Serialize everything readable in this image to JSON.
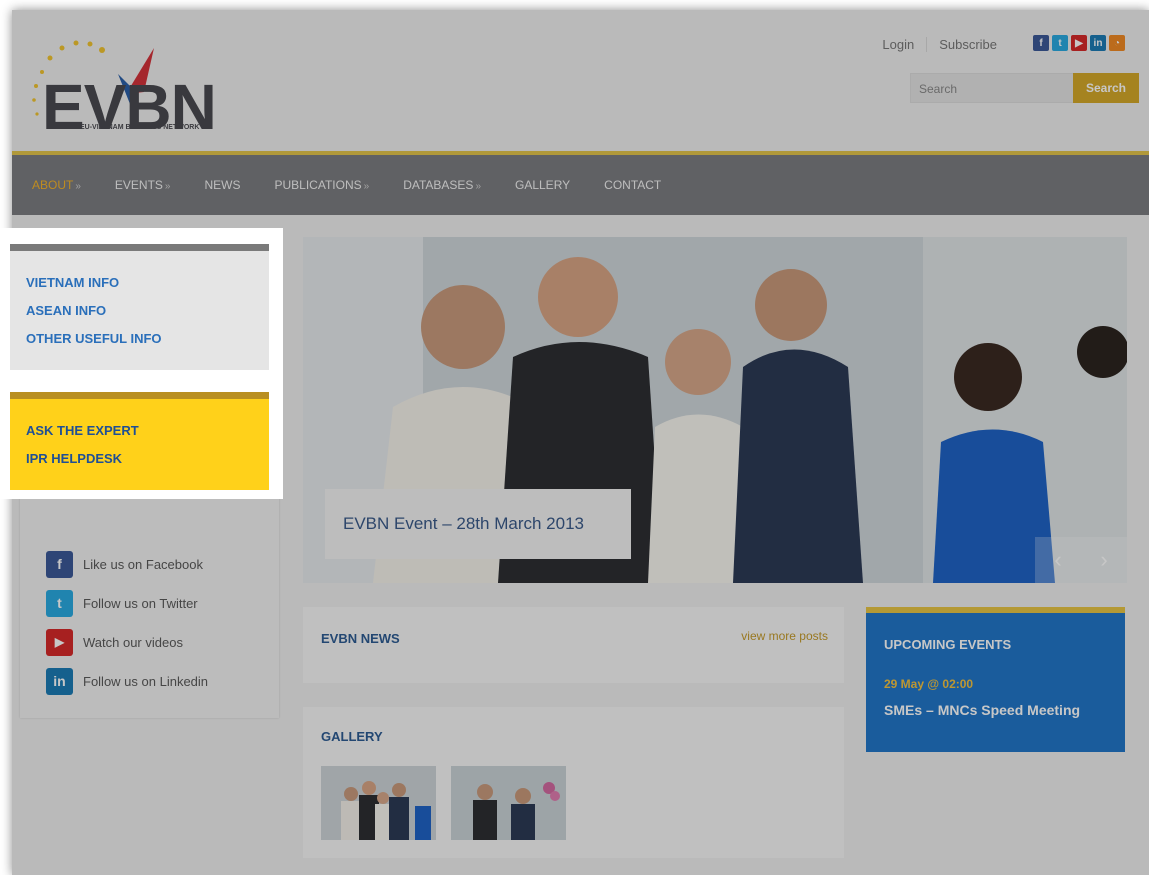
{
  "header": {
    "logo_text": "EVBN",
    "logo_subtitle": "EU-VIETNAM BUSINESS NETWORK",
    "login_label": "Login",
    "subscribe_label": "Subscribe",
    "social_icons": [
      "facebook-icon",
      "twitter-icon",
      "youtube-icon",
      "linkedin-icon",
      "rss-icon"
    ],
    "search_placeholder": "Search",
    "search_button": "Search"
  },
  "nav": {
    "items": [
      {
        "label": "ABOUT",
        "arrow": "»"
      },
      {
        "label": "EVENTS",
        "arrow": "»"
      },
      {
        "label": "NEWS",
        "arrow": ""
      },
      {
        "label": "PUBLICATIONS",
        "arrow": "»"
      },
      {
        "label": "DATABASES",
        "arrow": "»"
      },
      {
        "label": "GALLERY",
        "arrow": ""
      },
      {
        "label": "CONTACT",
        "arrow": ""
      }
    ]
  },
  "sidebar": {
    "info_links": [
      "VIETNAM INFO",
      "ASEAN INFO",
      "OTHER USEFUL INFO"
    ],
    "expert_links": [
      "ASK THE EXPERT",
      "IPR HELPDESK"
    ],
    "follow": [
      {
        "label": "Like us on Facebook",
        "icon": "facebook-icon",
        "color": "#3b5998",
        "glyph": "f"
      },
      {
        "label": "Follow us on Twitter",
        "icon": "twitter-icon",
        "color": "#2aa9e0",
        "glyph": "t"
      },
      {
        "label": "Watch our videos",
        "icon": "youtube-icon",
        "color": "#d62a2a",
        "glyph": "▶"
      },
      {
        "label": "Follow us on Linkedin",
        "icon": "linkedin-icon",
        "color": "#1c7bb5",
        "glyph": "in"
      }
    ]
  },
  "slider": {
    "caption": "EVBN Event – 28th March 2013",
    "prev": "‹",
    "next": "›"
  },
  "news": {
    "title": "EVBN NEWS",
    "more": "view more posts"
  },
  "gallery": {
    "title": "GALLERY"
  },
  "events": {
    "title": "UPCOMING EVENTS",
    "date": "29 May @ 02:00",
    "name": "SMEs – MNCs Speed Meeting"
  },
  "colors": {
    "nav_bg": "#7c7d80",
    "accent_yellow": "#ffd11a",
    "accent_blue": "#2276c8",
    "link_blue": "#2a6fba"
  }
}
